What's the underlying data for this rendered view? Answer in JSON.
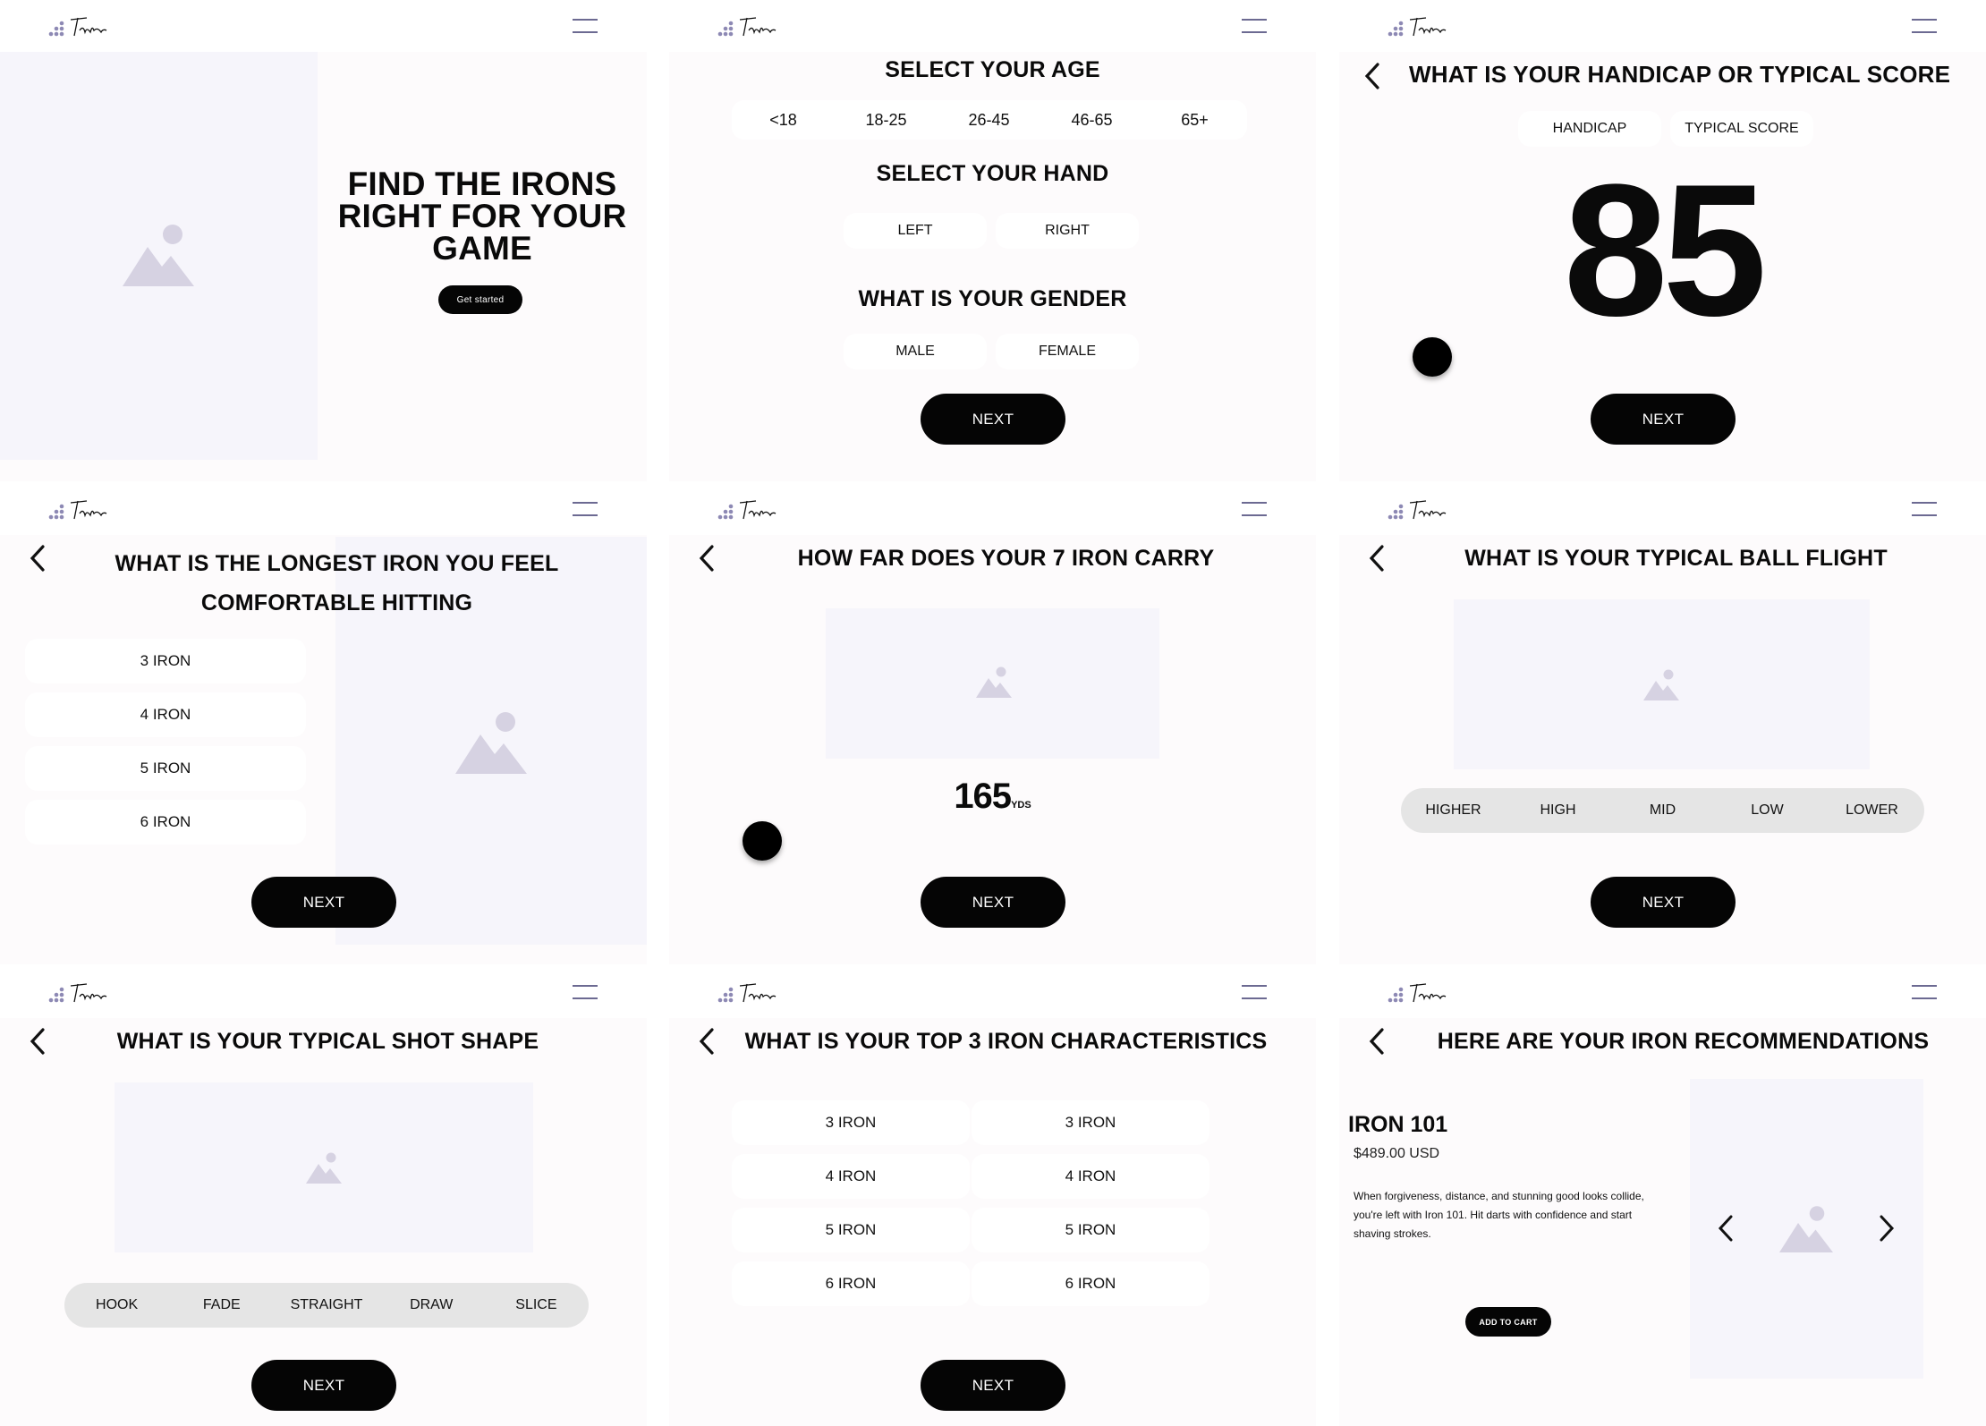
{
  "screens": {
    "welcome": {
      "headline_1": "FIND THE IRONS",
      "headline_2": "RIGHT FOR YOUR",
      "headline_3": "GAME",
      "cta": "Get started"
    },
    "profile": {
      "age_title": "SELECT YOUR AGE",
      "ages": [
        "<18",
        "18-25",
        "26-45",
        "46-65",
        "65+"
      ],
      "hand_title": "SELECT YOUR HAND",
      "hands": [
        "LEFT",
        "RIGHT"
      ],
      "gender_title": "WHAT IS YOUR GENDER",
      "genders": [
        "MALE",
        "FEMALE"
      ],
      "next": "NEXT"
    },
    "handicap": {
      "title": "WHAT IS YOUR HANDICAP OR TYPICAL SCORE",
      "tabs": [
        "HANDICAP",
        "TYPICAL SCORE"
      ],
      "value": "85",
      "next": "NEXT"
    },
    "longest_iron": {
      "title_1": "WHAT IS THE LONGEST IRON YOU FEEL",
      "title_2": "COMFORTABLE HITTING",
      "options": [
        "3 IRON",
        "4 IRON",
        "5 IRON",
        "6 IRON"
      ],
      "next": "NEXT"
    },
    "carry": {
      "title": "HOW FAR DOES YOUR 7 IRON CARRY",
      "value": "165",
      "unit": "YDS",
      "next": "NEXT"
    },
    "ball_flight": {
      "title": "WHAT IS YOUR TYPICAL BALL FLIGHT",
      "options": [
        "HIGHER",
        "HIGH",
        "MID",
        "LOW",
        "LOWER"
      ],
      "next": "NEXT"
    },
    "shot_shape": {
      "title": "WHAT IS YOUR TYPICAL SHOT SHAPE",
      "options": [
        "HOOK",
        "FADE",
        "STRAIGHT",
        "DRAW",
        "SLICE"
      ],
      "next": "NEXT"
    },
    "characteristics": {
      "title": "WHAT IS YOUR TOP 3 IRON CHARACTERISTICS",
      "left": [
        "3 IRON",
        "4 IRON",
        "5 IRON",
        "6 IRON"
      ],
      "right": [
        "3 IRON",
        "4 IRON",
        "5 IRON",
        "6 IRON"
      ],
      "next": "NEXT"
    },
    "recommendations": {
      "title": "HERE ARE YOUR IRON RECOMMENDATIONS",
      "product_name": "IRON 101",
      "price": "$489.00 USD",
      "desc_1": "When forgiveness, distance, and stunning good looks collide,",
      "desc_2": "you're left with Iron 101. Hit darts with confidence and start",
      "desc_3": "shaving strokes.",
      "cta": "ADD TO CART"
    }
  },
  "icons": {
    "logo": "brand-logo-icon",
    "menu": "hamburger-menu-icon",
    "back": "chevron-left-icon",
    "image": "image-placeholder-icon"
  },
  "colors": {
    "accent": "#000000",
    "panel_bg": "#fdfbfc",
    "placeholder_bg": "#f6f5fb",
    "placeholder_icon": "#d6d2e2",
    "menu_icon": "#6c6a92",
    "segment_bg": "#e5e5e5"
  }
}
